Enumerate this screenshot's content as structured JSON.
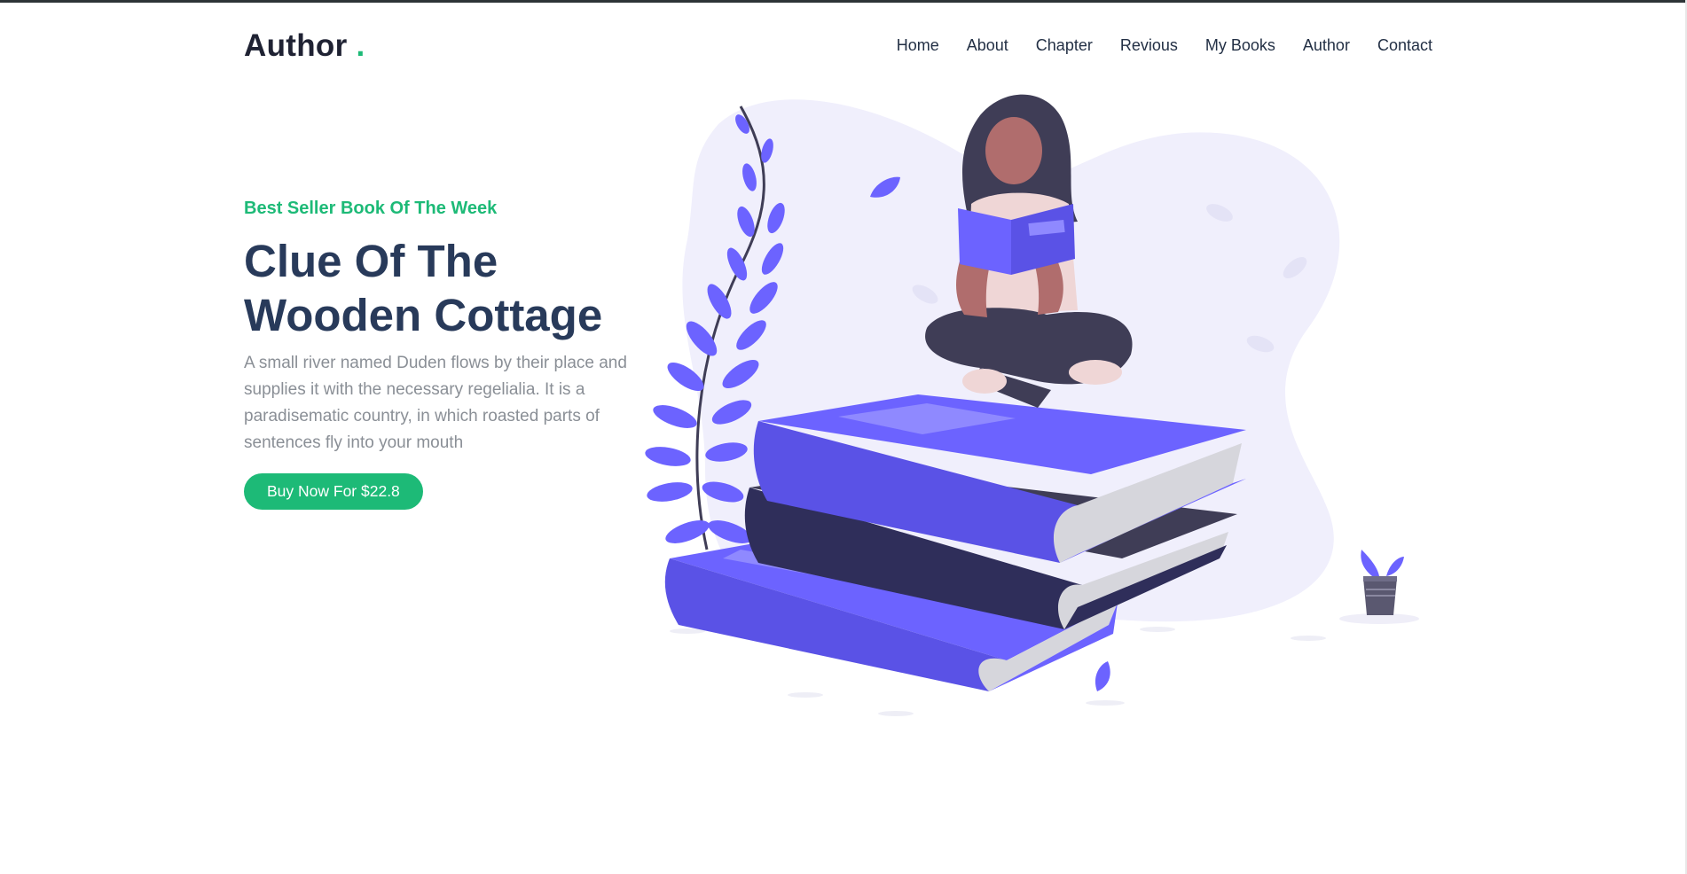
{
  "brand": {
    "name": "Author",
    "dot": "."
  },
  "nav": {
    "items": [
      "Home",
      "About",
      "Chapter",
      "Revious",
      "My Books",
      "Author",
      "Contact"
    ]
  },
  "hero": {
    "eyebrow": "Best Seller Book Of The Week",
    "title_line1": "Clue Of The",
    "title_line2": "Wooden Cottage",
    "description": "A small river named Duden flows by their place and supplies it with the necessary regelialia. It is a paradisematic country, in which roasted parts of sentences fly into your mouth",
    "cta_label": "Buy Now For $22.8"
  },
  "colors": {
    "accent": "#1dba77",
    "heading": "#283a5a",
    "book_purple": "#6c63ff",
    "book_dark": "#2f2e5a",
    "blob": "#f0effc"
  },
  "illustration": {
    "icon": "woman-reading-on-books-illustration"
  }
}
